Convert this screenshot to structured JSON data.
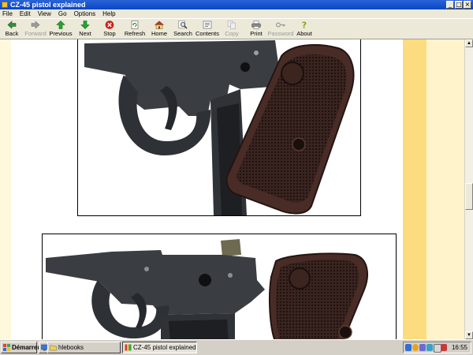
{
  "window": {
    "title": "CZ-45 pistol explained"
  },
  "menu": [
    "File",
    "Edit",
    "View",
    "Go",
    "Options",
    "Help"
  ],
  "toolbar": [
    {
      "label": "Back",
      "icon": "back-arrow-icon",
      "enabled": true
    },
    {
      "label": "Forward",
      "icon": "forward-arrow-icon",
      "enabled": false
    },
    {
      "label": "Previous",
      "icon": "up-arrow-icon",
      "enabled": true
    },
    {
      "label": "Next",
      "icon": "down-arrow-icon",
      "enabled": true
    },
    {
      "label": "Stop",
      "icon": "stop-icon",
      "enabled": true
    },
    {
      "label": "Refresh",
      "icon": "refresh-icon",
      "enabled": true
    },
    {
      "label": "Home",
      "icon": "home-icon",
      "enabled": true
    },
    {
      "label": "Search",
      "icon": "search-icon",
      "enabled": true
    },
    {
      "label": "Contents",
      "icon": "contents-icon",
      "enabled": true
    },
    {
      "label": "Copy",
      "icon": "copy-icon",
      "enabled": false
    },
    {
      "label": "Print",
      "icon": "print-icon",
      "enabled": true
    },
    {
      "label": "Password",
      "icon": "key-icon",
      "enabled": false
    },
    {
      "label": "About",
      "icon": "question-icon",
      "enabled": true
    }
  ],
  "taskbar": {
    "start_label": "Démarrer",
    "items": [
      {
        "label": "hlebooks",
        "icon": "folder-icon",
        "active": false
      },
      {
        "label": "CZ-45 pistol explained",
        "icon": "book-icon",
        "active": true
      }
    ],
    "clock": "16:55"
  },
  "colors": {
    "titlebar": "#0a46c4",
    "stripe_left": "#fef8dd",
    "stripe_mid": "#fbdc7e",
    "stripe_right": "#fef3cb",
    "gun_metal": "#3a3d42",
    "grip_brown": "#4a2c26"
  }
}
